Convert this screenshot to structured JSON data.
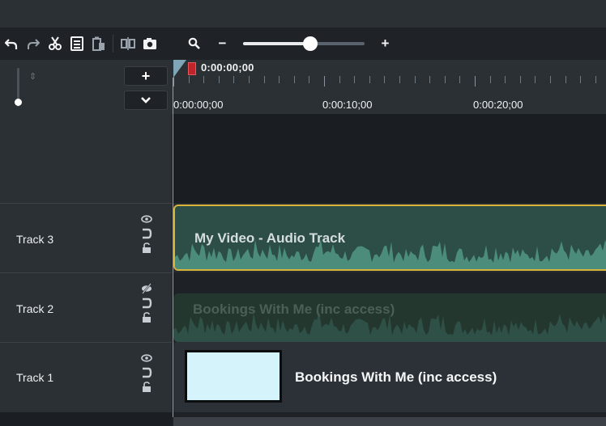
{
  "toolbar": {
    "undo_icon": "↶",
    "redo_icon": "↷",
    "cut_icon": "✂",
    "copy_icon": "▤",
    "paste_icon": "📋",
    "split_icon": "⫴",
    "snapshot_icon": "◙",
    "search_icon": "🔍",
    "zoom_out_label": "−",
    "zoom_in_label": "+",
    "zoom_level": 0.55
  },
  "header": {
    "add_track_label": "+",
    "collapse_label": "⌄",
    "playhead_time": "0:00:00;00",
    "ruler_labels": [
      "0:00:00;00",
      "0:00:10;00",
      "0:00:20;00"
    ]
  },
  "tracks": [
    {
      "label": "Track 3",
      "visibility_icon": "👁",
      "magnet_icon": "⊃",
      "lock_icon": "🔓",
      "clip_title": "My Video - Audio Track"
    },
    {
      "label": "Track 2",
      "visibility_icon": "⊘",
      "magnet_icon": "⊃",
      "lock_icon": "🔓",
      "clip_title": "Bookings With Me (inc access)"
    },
    {
      "label": "Track 1",
      "visibility_icon": "👁",
      "magnet_icon": "⊃",
      "lock_icon": "🔓",
      "clip_title": "Bookings With Me (inc access)"
    }
  ],
  "colors": {
    "audio_clip": "#2c4e46",
    "selected_border": "#d8b43a",
    "playhead": "#c0232a",
    "thumbnail": "#d4f3fa"
  }
}
